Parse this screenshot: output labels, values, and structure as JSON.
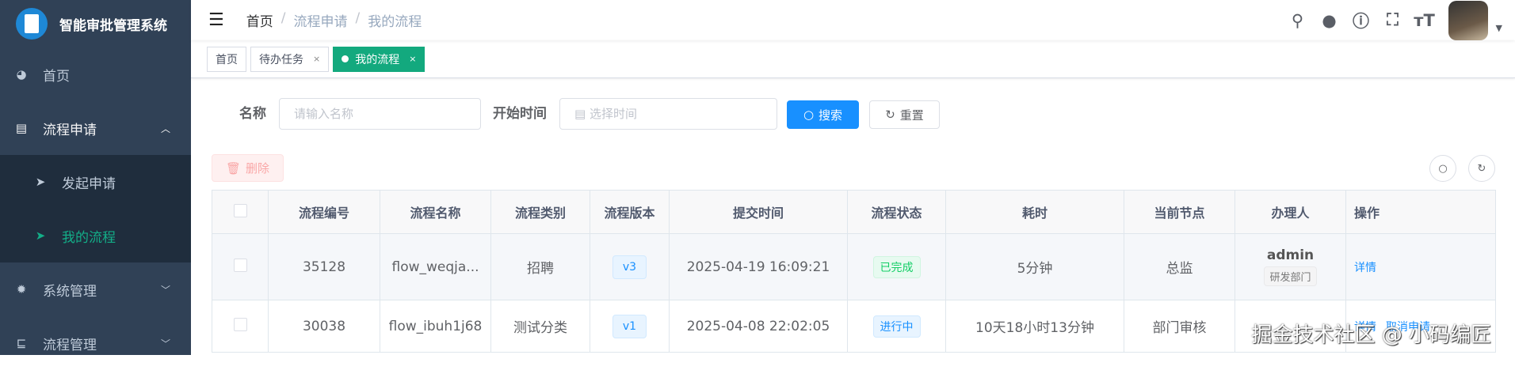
{
  "app": {
    "title": "智能审批管理系统"
  },
  "sidebar": {
    "items": [
      {
        "label": "首页",
        "icon": "dashboard-icon"
      },
      {
        "label": "流程申请",
        "icon": "document-icon"
      },
      {
        "label": "发起申请",
        "icon": "send-icon"
      },
      {
        "label": "我的流程",
        "icon": "send-icon"
      },
      {
        "label": "系统管理",
        "icon": "gear-icon"
      },
      {
        "label": "流程管理",
        "icon": "tree-icon"
      }
    ]
  },
  "breadcrumb": [
    "首页",
    "流程申请",
    "我的流程"
  ],
  "tags": [
    {
      "label": "首页"
    },
    {
      "label": "待办任务"
    },
    {
      "label": "我的流程"
    }
  ],
  "search": {
    "name_label": "名称",
    "name_placeholder": "请输入名称",
    "time_label": "开始时间",
    "time_placeholder": "选择时间",
    "search_label": "搜索",
    "reset_label": "重置"
  },
  "toolbar": {
    "delete_label": "删除"
  },
  "table": {
    "headers": [
      "流程编号",
      "流程名称",
      "流程类别",
      "流程版本",
      "提交时间",
      "流程状态",
      "耗时",
      "当前节点",
      "办理人",
      "操作"
    ],
    "rows": [
      {
        "id": "35128",
        "name": "flow_weqja...",
        "category": "招聘",
        "version": "v3",
        "time": "2025-04-19 16:09:21",
        "status": "已完成",
        "duration": "5分钟",
        "node": "总监",
        "user": "admin",
        "dept": "研发部门",
        "ops": [
          "详情"
        ]
      },
      {
        "id": "30038",
        "name": "flow_ibuh1j68",
        "category": "测试分类",
        "version": "v1",
        "time": "2025-04-08 22:02:05",
        "status": "进行中",
        "duration": "10天18小时13分钟",
        "node": "部门审核",
        "user": "",
        "dept": "",
        "ops": [
          "详情",
          "取消申请"
        ]
      }
    ]
  },
  "watermark": "掘金技术社区 @ 小码编匠",
  "colors": {
    "sidebar": "#304156",
    "accent": "#13a97e",
    "primary": "#1890ff"
  }
}
